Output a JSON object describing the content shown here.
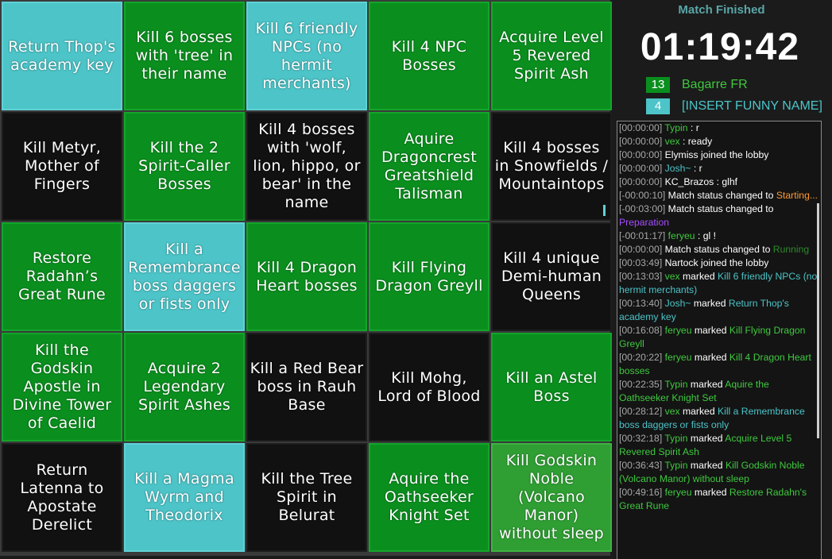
{
  "board": {
    "cells": [
      {
        "text": "Return Thop's academy key",
        "state": "teal"
      },
      {
        "text": "Kill 6 bosses with 'tree' in their name",
        "state": "green"
      },
      {
        "text": "Kill 6 friendly NPCs (no hermit merchants)",
        "state": "teal"
      },
      {
        "text": "Kill 4 NPC Bosses",
        "state": "green"
      },
      {
        "text": "Acquire Level 5 Revered Spirit Ash",
        "state": "green"
      },
      {
        "text": "Kill Metyr, Mother of Fingers",
        "state": "black"
      },
      {
        "text": "Kill the 2 Spirit-Caller Bosses",
        "state": "green"
      },
      {
        "text": "Kill 4 bosses with 'wolf, lion, hippo, or bear' in the name",
        "state": "black"
      },
      {
        "text": "Aquire Dragoncrest Greatshield Talisman",
        "state": "green"
      },
      {
        "text": "Kill 4 bosses in Snowfields / Mountaintops",
        "state": "black"
      },
      {
        "text": "Restore Radahn’s Great Rune",
        "state": "green"
      },
      {
        "text": "Kill a Remembrance boss daggers or fists only",
        "state": "teal"
      },
      {
        "text": "Kill 4 Dragon Heart bosses",
        "state": "green"
      },
      {
        "text": "Kill Flying Dragon Greyll",
        "state": "green"
      },
      {
        "text": "Kill 4 unique Demi-human Queens",
        "state": "black"
      },
      {
        "text": "Kill the Godskin Apostle in Divine Tower of Caelid",
        "state": "green"
      },
      {
        "text": "Acquire 2 Legendary Spirit Ashes",
        "state": "green"
      },
      {
        "text": "Kill a Red Bear boss in Rauh Base",
        "state": "black"
      },
      {
        "text": "Kill Mohg, Lord of Blood",
        "state": "black"
      },
      {
        "text": "Kill an Astel Boss",
        "state": "green"
      },
      {
        "text": "Return Latenna to Apostate Derelict",
        "state": "black"
      },
      {
        "text": "Kill a Magma Wyrm and Theodorix",
        "state": "teal"
      },
      {
        "text": "Kill the Tree Spirit in Belurat",
        "state": "black"
      },
      {
        "text": "Aquire the Oathseeker Knight Set",
        "state": "green"
      },
      {
        "text": "Kill Godskin Noble (Volcano Manor) without sleep",
        "state": "lightgreen"
      }
    ]
  },
  "match": {
    "status": "Match Finished",
    "timer": "01:19:42"
  },
  "teams": [
    {
      "score": "13",
      "name": "Bagarre FR",
      "color": "#0a8f1e",
      "text_color": "#3fc93f"
    },
    {
      "score": "4",
      "name": "[INSERT FUNNY NAME]",
      "color": "#4cc4c8",
      "text_color": "#4cc4c8"
    }
  ],
  "chat": [
    {
      "ts": "[00:00:00]",
      "user": "Typin",
      "user_color": "green",
      "msg": " : r"
    },
    {
      "ts": "[00:00:00]",
      "user": "vex",
      "user_color": "green",
      "msg": " : ready"
    },
    {
      "ts": "[00:00:00]",
      "user": "",
      "msg": " Elymiss joined the lobby"
    },
    {
      "ts": "[00:00:00]",
      "user": "Josh~",
      "user_color": "teal",
      "msg": " : r"
    },
    {
      "ts": "[00:00:00]",
      "user": "",
      "msg": " KC_Brazos : glhf"
    },
    {
      "ts": "[-00:00:10]",
      "user": "",
      "msg": " Match status changed to ",
      "tail": "Starting...",
      "tail_color": "#ff9a2e"
    },
    {
      "ts": "[-00:03:00]",
      "user": "",
      "msg": " Match status changed to ",
      "tail": "Preparation",
      "tail_color": "#a64dff"
    },
    {
      "ts": "[-00:01:17]",
      "user": "feryeu",
      "user_color": "green",
      "msg": " : gl !"
    },
    {
      "ts": "[00:00:00]",
      "user": "",
      "msg": " Match status changed to ",
      "tail": "Running",
      "tail_color": "#2b8a2b"
    },
    {
      "ts": "[00:03:49]",
      "user": "",
      "msg": " Nartock joined the lobby"
    },
    {
      "ts": "[00:13:03]",
      "user": "vex",
      "user_color": "green",
      "msg": " marked ",
      "tail": "Kill 6 friendly NPCs (no hermit merchants)",
      "tail_color": "#4cc4c8"
    },
    {
      "ts": "[00:13:40]",
      "user": "Josh~",
      "user_color": "teal",
      "msg": " marked ",
      "tail": "Return Thop's academy key",
      "tail_color": "#4cc4c8"
    },
    {
      "ts": "[00:16:08]",
      "user": "feryeu",
      "user_color": "green",
      "msg": " marked ",
      "tail": "Kill Flying Dragon Greyll",
      "tail_color": "#3fc93f"
    },
    {
      "ts": "[00:20:22]",
      "user": "feryeu",
      "user_color": "green",
      "msg": " marked ",
      "tail": "Kill 4 Dragon Heart bosses",
      "tail_color": "#3fc93f"
    },
    {
      "ts": "[00:22:35]",
      "user": "Typin",
      "user_color": "green",
      "msg": " marked ",
      "tail": "Aquire the Oathseeker Knight Set",
      "tail_color": "#3fc93f"
    },
    {
      "ts": "[00:28:12]",
      "user": "vex",
      "user_color": "green",
      "msg": " marked ",
      "tail": "Kill a Remembrance boss daggers or fists only",
      "tail_color": "#4cc4c8"
    },
    {
      "ts": "[00:32:18]",
      "user": "Typin",
      "user_color": "green",
      "msg": " marked ",
      "tail": "Acquire Level 5 Revered Spirit Ash",
      "tail_color": "#3fc93f"
    },
    {
      "ts": "[00:36:43]",
      "user": "Typin",
      "user_color": "green",
      "msg": " marked ",
      "tail": "Kill Godskin Noble (Volcano Manor) without sleep",
      "tail_color": "#3fc93f"
    },
    {
      "ts": "[00:49:16]",
      "user": "feryeu",
      "user_color": "green",
      "msg": " marked ",
      "tail": "Restore Radahn's Great Rune",
      "tail_color": "#3fc93f"
    }
  ]
}
